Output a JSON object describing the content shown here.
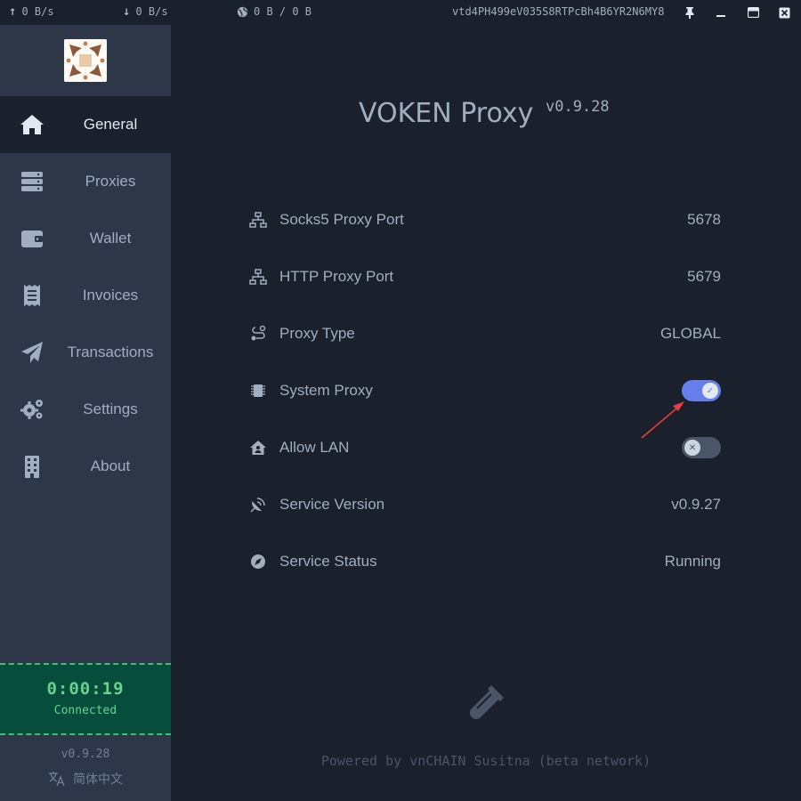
{
  "topbar": {
    "upload_speed": "0 B/s",
    "download_speed": "0 B/s",
    "traffic": "0 B / 0 B",
    "wallet_address": "vtd4PH499eV035S8RTPcBh4B6YR2N6MY8"
  },
  "sidebar": {
    "items": [
      {
        "label": "General",
        "icon": "home-icon"
      },
      {
        "label": "Proxies",
        "icon": "server-icon"
      },
      {
        "label": "Wallet",
        "icon": "wallet-icon"
      },
      {
        "label": "Invoices",
        "icon": "receipt-icon"
      },
      {
        "label": "Transactions",
        "icon": "paper-plane-icon"
      },
      {
        "label": "Settings",
        "icon": "gears-icon"
      },
      {
        "label": "About",
        "icon": "building-icon"
      }
    ],
    "timer": "0:00:19",
    "status": "Connected",
    "version": "v0.9.28",
    "language": "简体中文"
  },
  "main": {
    "title": "VOKEN Proxy",
    "version": "v0.9.28",
    "rows": [
      {
        "label": "Socks5 Proxy Port",
        "value": "5678",
        "icon": "network-icon"
      },
      {
        "label": "HTTP Proxy Port",
        "value": "5679",
        "icon": "network-icon"
      },
      {
        "label": "Proxy Type",
        "value": "GLOBAL",
        "icon": "route-icon"
      },
      {
        "label": "System Proxy",
        "toggle": true,
        "icon": "chip-icon"
      },
      {
        "label": "Allow LAN",
        "toggle": false,
        "icon": "house-user-icon"
      },
      {
        "label": "Service Version",
        "value": "v0.9.27",
        "icon": "satellite-dish-icon"
      },
      {
        "label": "Service Status",
        "value": "Running",
        "icon": "compass-icon"
      }
    ],
    "powered_by": "Powered by vnCHAIN Susitna (beta network)"
  },
  "colors": {
    "background": "#1a202c",
    "sidebar": "#2d3748",
    "toggle_on": "#667eea",
    "connected_green": "#68d391",
    "annotation_arrow": "#e53e3e"
  }
}
